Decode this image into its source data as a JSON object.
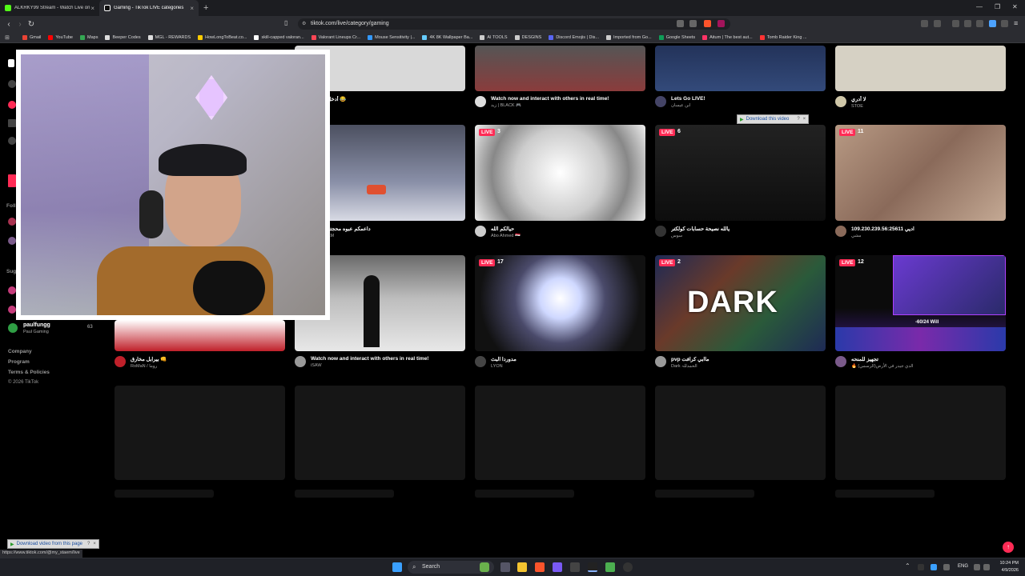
{
  "browser": {
    "tabs": [
      {
        "label": "ALKRKY99 Stream - Watch Live on K",
        "favicon_color": "#53fc18"
      },
      {
        "label": "Gaming - TikTok LIVE categories",
        "favicon_color": "#ffffff"
      }
    ],
    "url": "tiktok.com/live/category/gaming",
    "bookmarks": [
      {
        "label": "Gmail",
        "color": "#ea4335"
      },
      {
        "label": "YouTube",
        "color": "#ff0000"
      },
      {
        "label": "Maps",
        "color": "#34a853"
      },
      {
        "label": "Beeper Codes",
        "color": "#dddddd"
      },
      {
        "label": "MGL - REWARDS",
        "color": "#dddddd"
      },
      {
        "label": "HowLongToBeat.co...",
        "color": "#ffcc00"
      },
      {
        "label": "skill-capped valoran...",
        "color": "#ffffff"
      },
      {
        "label": "Valorant Lineups Cr...",
        "color": "#ff4655"
      },
      {
        "label": "Mouse Sensitivity |...",
        "color": "#3399ff"
      },
      {
        "label": "4K 8K Wallpaper Ba...",
        "color": "#66ccff"
      },
      {
        "label": "AI TOOLS",
        "color": "#cccccc"
      },
      {
        "label": "DESGINS",
        "color": "#cccccc"
      },
      {
        "label": "Discord Emojis | Dis...",
        "color": "#5865f2"
      },
      {
        "label": "Imported from Go...",
        "color": "#cccccc"
      },
      {
        "label": "Google Sheets",
        "color": "#0f9d58"
      },
      {
        "label": "Aitum | The best aut...",
        "color": "#ff3366"
      },
      {
        "label": "Tomb Raider King ...",
        "color": "#ff3333"
      }
    ]
  },
  "sidebar": {
    "suggested_user": {
      "name": "paulfungg",
      "subtitle": "Paul Gaming",
      "count": "63"
    },
    "footer": [
      "Company",
      "Program",
      "Terms & Policies",
      "© 2026 TikTok"
    ]
  },
  "grid": {
    "live_label": "LIVE",
    "row1": [
      {
        "title": "أدخل شحالك 😂",
        "author": "",
        "color": "#d9d9d9"
      },
      {
        "title": "Watch now and interact with others in real time!",
        "author": "زيد | BLACK 🎮",
        "color": "#8a3c3c"
      },
      {
        "title": "Lets Go LIVE!",
        "author": "ابن عيسان",
        "color": "#334a7a"
      },
      {
        "title": "لا أدري",
        "author": "STOE",
        "color": "#d6d1c4"
      }
    ],
    "row2": [
      {
        "title": "داعمكم عبوه محجتكم انزجو",
        "author": "ABU-ARAM",
        "viewers": "",
        "color": "#6b7080"
      },
      {
        "title": "حيالكم الله",
        "author": "Abo Ahmed 🇮🇶",
        "viewers": "3",
        "color": "#e9e9e9"
      },
      {
        "title": "يالله نصيحة حسابات كولكتر",
        "author": "سوس",
        "viewers": "6",
        "color": "#1a1a1a"
      },
      {
        "title": "109.230.239.56:25611 اديي",
        "author": "مشي",
        "viewers": "11",
        "color": "#8a6a5a"
      }
    ],
    "row3": [
      {
        "title": "بيرابل مخارق 👊",
        "author": "RoMaN / روما",
        "viewers": "",
        "color": "#c0202a"
      },
      {
        "title": "Watch now and interact with others in real time!",
        "author": "iSAW",
        "viewers": "",
        "color": "#8c8c8c"
      },
      {
        "title": "مدوردا البث",
        "author": "LYON",
        "viewers": "17",
        "color": "#2a2a3a"
      },
      {
        "title": "pvp ماابي كرافت",
        "author": "Dark الحمدللہ",
        "viewers": "2",
        "color": "#1e2a55",
        "overlay": "DARK"
      },
      {
        "title": "تجهيز للمنحه",
        "author": "🔥 الدي جيدر في الأرض(الرسمي)",
        "viewers": "12",
        "color": "#3a1a7a",
        "stream_overlay": "-60/24 Will"
      }
    ]
  },
  "overlays": {
    "download_video": "Download this video",
    "download_page": "Download video from this page",
    "status_url": "https://www.tiktok.com/@my_staem/live"
  },
  "taskbar": {
    "search_placeholder": "Search",
    "lang": "ENG",
    "time": "10:24 PM",
    "date": "4/9/2026"
  }
}
